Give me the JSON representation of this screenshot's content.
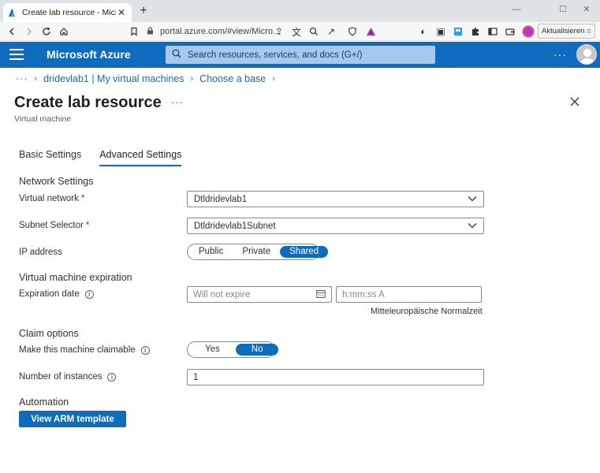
{
  "browser": {
    "tab_title": "Create lab resource - Microsoft Azure",
    "url": "portal.azure.com/#view/Micro...",
    "update_label": "Aktualisieren"
  },
  "azure": {
    "brand": "Microsoft Azure",
    "search_placeholder": "Search resources, services, and docs (G+/)"
  },
  "breadcrumb": {
    "ellipsis": "···",
    "items": [
      "dridevlab1 | My virtual machines",
      "Choose a base"
    ]
  },
  "page": {
    "title": "Create lab resource",
    "subtitle": "Virtual machine"
  },
  "tabs": [
    "Basic Settings",
    "Advanced Settings"
  ],
  "network": {
    "heading": "Network Settings",
    "virtual_network_label": "Virtual network",
    "virtual_network_value": "Dtldridevlab1",
    "subnet_label": "Subnet Selector",
    "subnet_value": "Dtldridevlab1Subnet",
    "ip_label": "IP address",
    "ip_options": [
      "Public",
      "Private",
      "Shared"
    ],
    "ip_selected": "Shared"
  },
  "expiration": {
    "heading": "Virtual machine expiration",
    "date_label": "Expiration date",
    "date_placeholder": "Will not expire",
    "time_placeholder": "h:mm:ss A",
    "timezone": "Mitteleuropäische Normalzeit"
  },
  "claim": {
    "heading": "Claim options",
    "claimable_label": "Make this machine claimable",
    "options": [
      "Yes",
      "No"
    ],
    "selected": "No",
    "instances_label": "Number of instances",
    "instances_value": "1"
  },
  "automation": {
    "heading": "Automation",
    "arm_button": "View ARM template"
  },
  "colors": {
    "accent": "#0f6cbd",
    "required": "#a4262c"
  }
}
